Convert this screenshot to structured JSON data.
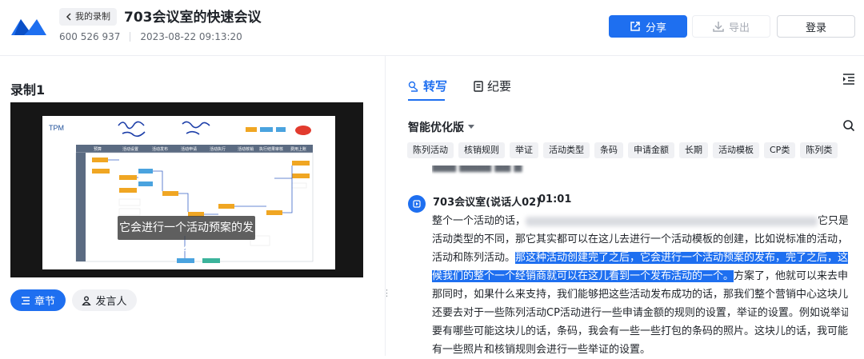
{
  "header": {
    "back_label": "我的录制",
    "meeting_title": "703会议室的快速会议",
    "meeting_id": "600 526 937",
    "datetime": "2023-08-22 09:13:20",
    "share_label": "分享",
    "export_label": "导出",
    "login_label": "登录"
  },
  "left": {
    "recording_title": "录制1",
    "caption": "它会进行一个活动预案的发布",
    "chapter_label": "章节",
    "speaker_label": "发言人"
  },
  "slide": {
    "heading": "TPM",
    "columns": [
      "预算",
      "活动设置",
      "活动发布",
      "活动申请",
      "活动执行",
      "活动核销",
      "执行结果审核",
      "费用上账"
    ]
  },
  "right": {
    "tab_transcribe": "转写",
    "tab_minutes": "纪要",
    "smart_version": "智能优化版",
    "tags": [
      "陈列活动",
      "核销规则",
      "举证",
      "活动类型",
      "条码",
      "申请金额",
      "长期",
      "活动模板",
      "CP类",
      "陈列类"
    ],
    "speaker_name": "703会议室(说话人02)",
    "speaker_time": "01:01",
    "lines": {
      "l1a": "整个一个活动的话，",
      "l1b": "它只是",
      "l2": "活动类型的不同，那它其实都可以在这儿去进行一个活动模板的创建，比如说标准的活动，临处",
      "l3a": "活动和陈列活动。",
      "l3b": "那这种活动创建完了之后，它会进行一个活动预案的发布，完了之后，这个时",
      "l4a": "候我们的整个一个经销商就可以在这儿看到一个发布活动的一个。",
      "l4b": "方案了，他就可以来去申请。",
      "l5": "那同时，如果什么来支持，我们能够把这些活动发布成功的话，那我们整个营销中心这块儿，它",
      "l6": "还要去对于一些陈列活动CP活动进行一些申请金额的规则的设置，举证的设置。例如说举证，我",
      "l7": "要有哪些可能这块儿的话，条码，我会有一些一些打包的条码的照片。这块儿的话，我可能也会",
      "l8": "有一些照片和核销规则会进行一些举证的设置。"
    }
  }
}
